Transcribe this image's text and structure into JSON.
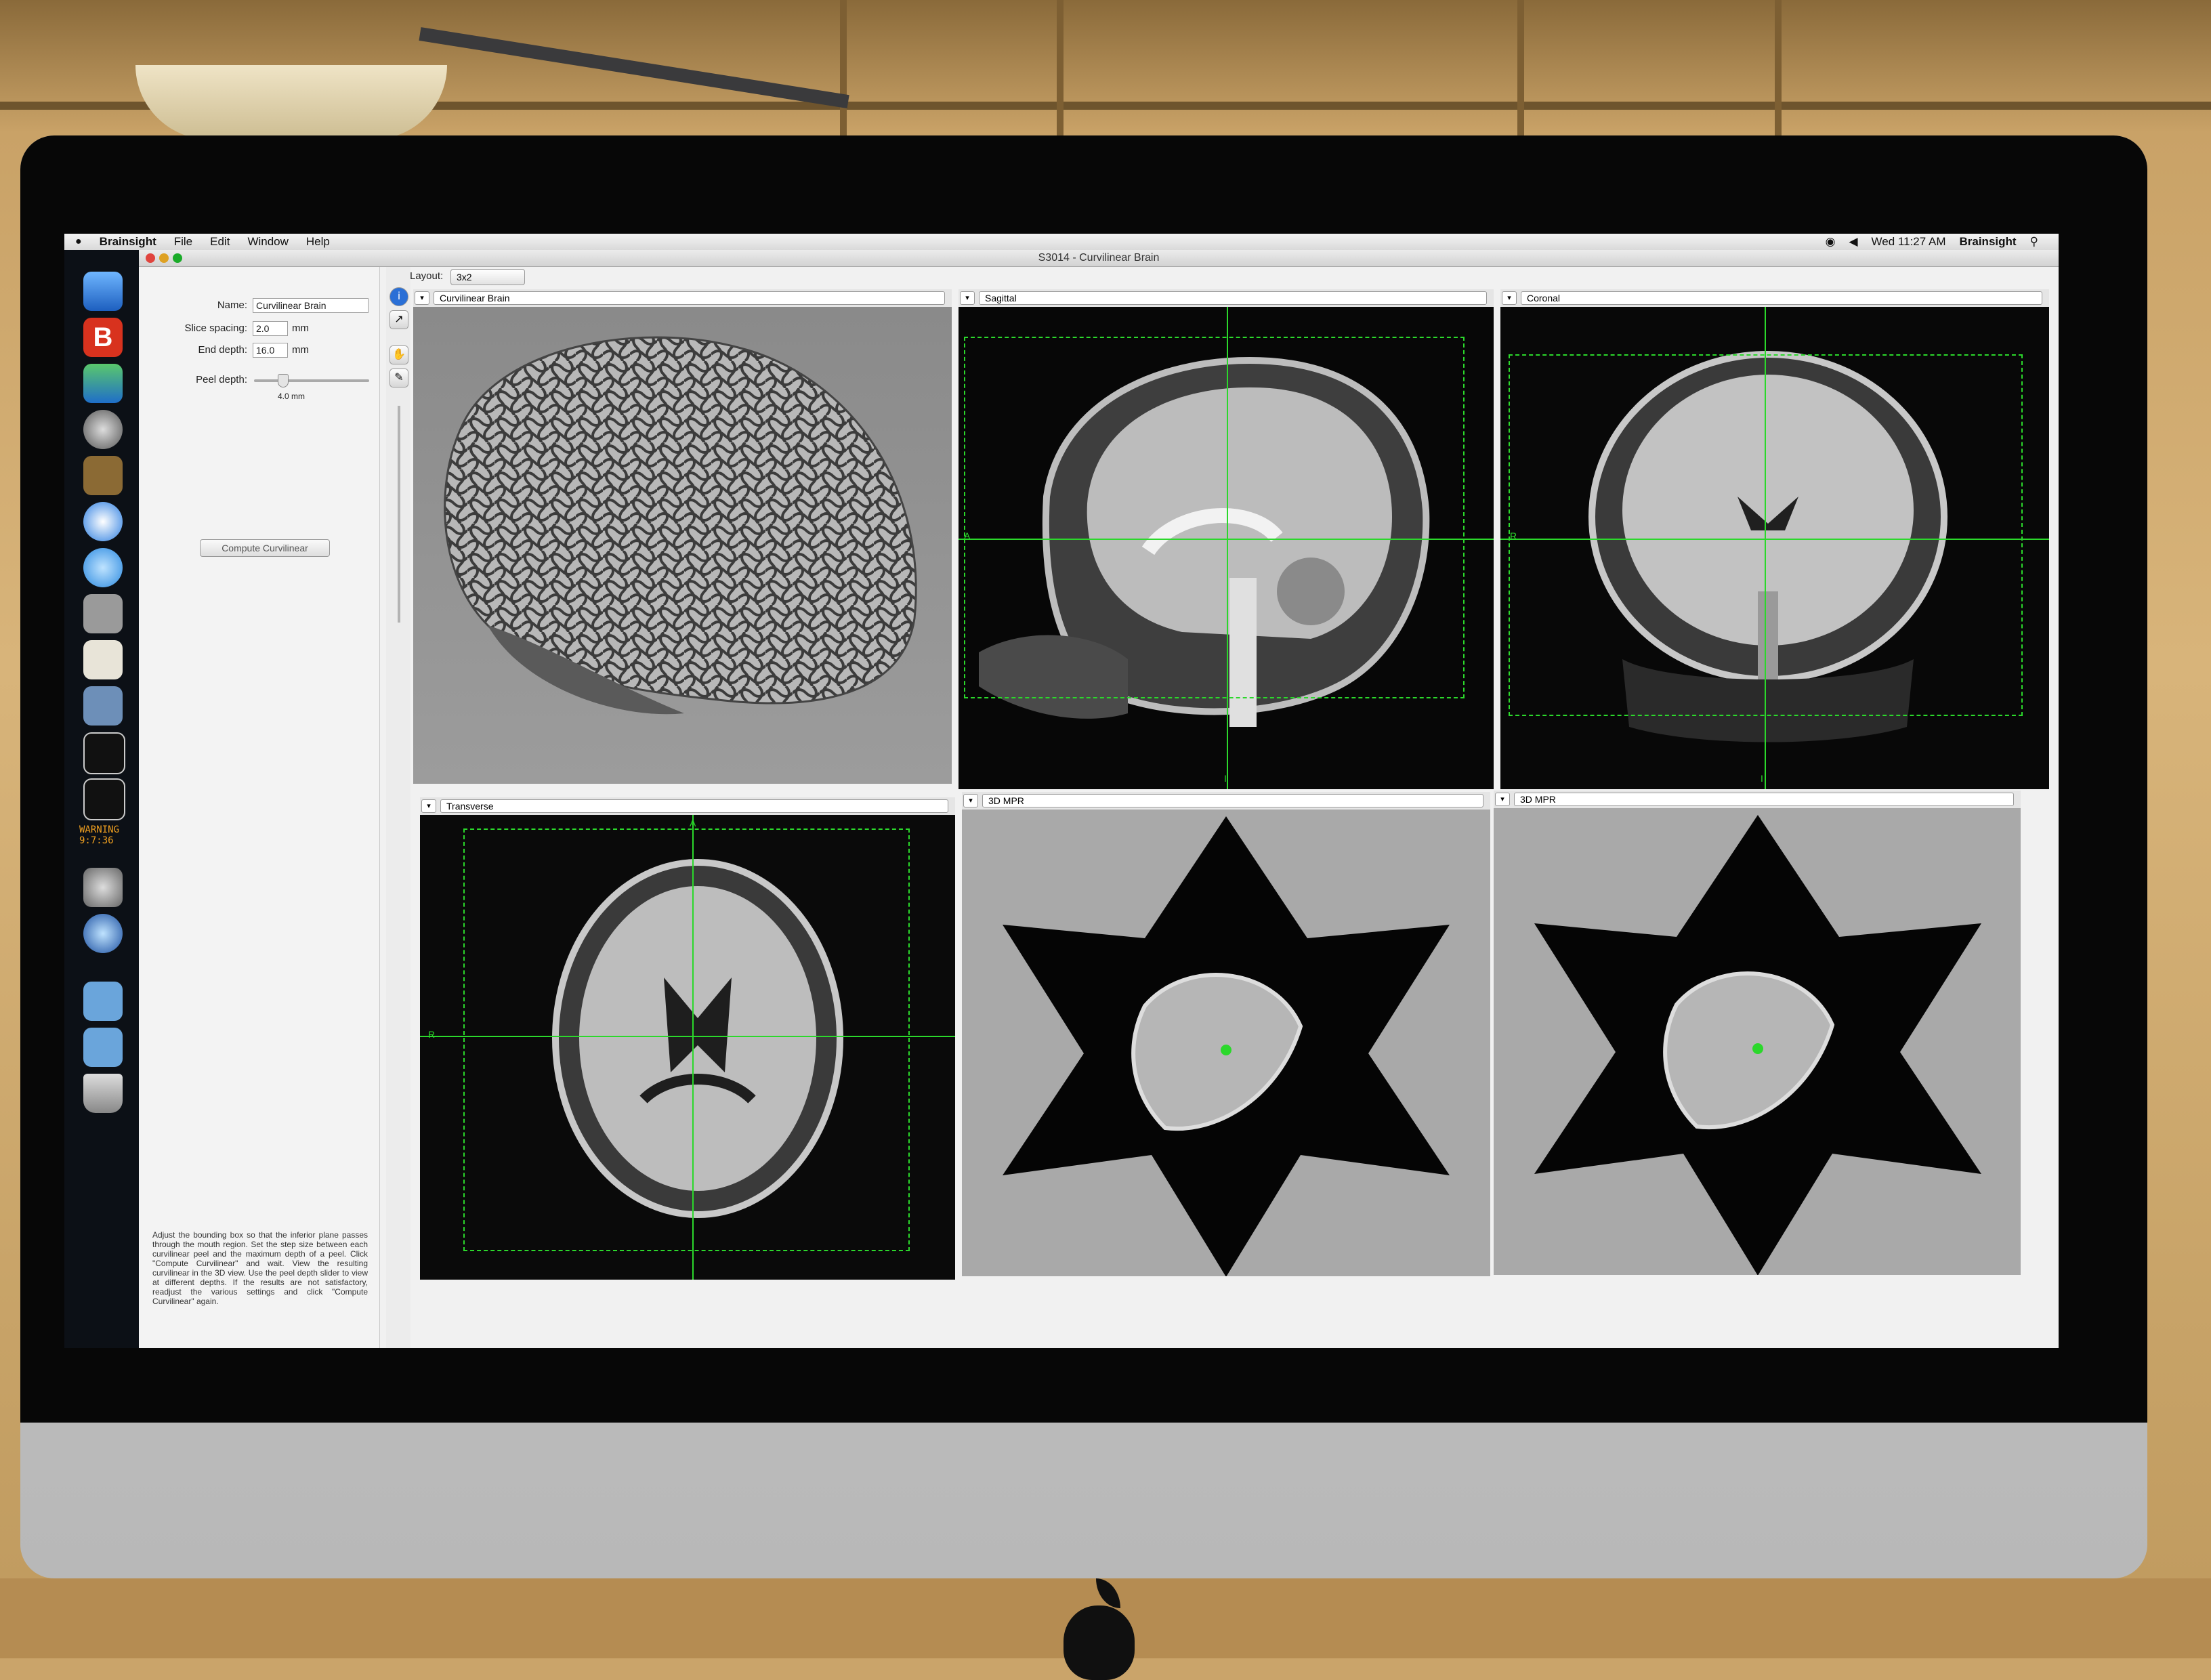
{
  "menubar": {
    "app": "Brainsight",
    "menus": [
      "File",
      "Edit",
      "Window",
      "Help"
    ],
    "clock": "Wed 11:27 AM",
    "user": "Brainsight"
  },
  "window": {
    "title": "S3014 - Curvilinear Brain"
  },
  "left_panel": {
    "name_label": "Name:",
    "name_value": "Curvilinear Brain",
    "slice_spacing_label": "Slice spacing:",
    "slice_spacing_value": "2.0",
    "end_depth_label": "End depth:",
    "end_depth_value": "16.0",
    "unit": "mm",
    "peel_depth_label": "Peel depth:",
    "peel_depth_value": "4.0 mm",
    "compute_button": "Compute Curvilinear",
    "help_text": "Adjust the bounding box so that the inferior plane passes through the mouth region. Set the step size between each curvilinear peel and the maximum depth of a peel. Click \"Compute Curvilinear\" and wait. View the resulting curvilinear in the 3D view. Use the peel depth slider to view at different depths. If the results are not satisfactory, readjust the various settings and click \"Compute Curvilinear\" again."
  },
  "layout": {
    "label": "Layout:",
    "value": "3x2"
  },
  "views": [
    {
      "title": "Curvilinear Brain"
    },
    {
      "title": "Sagittal"
    },
    {
      "title": "Coronal"
    },
    {
      "title": "Transverse"
    },
    {
      "title": "3D MPR"
    },
    {
      "title": "3D MPR"
    }
  ],
  "orient": {
    "sag_a": "A",
    "sag_i": "I",
    "cor_r": "R",
    "cor_i": "I",
    "tra_a": "A",
    "tra_r": "R"
  },
  "dock_badge": "WARNING",
  "dock_time": "9:7:36",
  "colors": {
    "crosshair": "#2bd82b",
    "dock_bg": "#0c1016"
  }
}
